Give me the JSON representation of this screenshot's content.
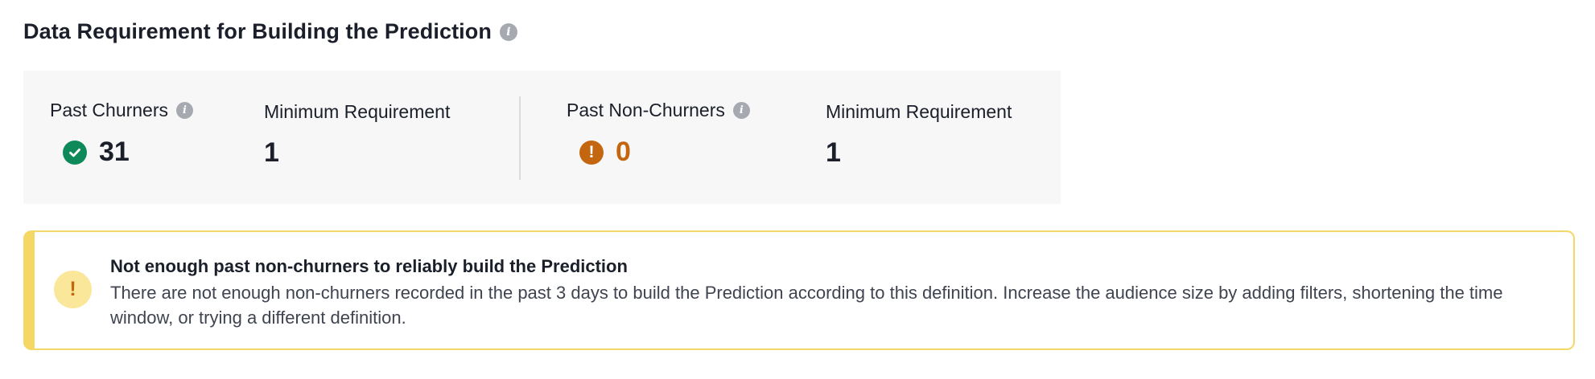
{
  "section": {
    "title": "Data Requirement for Building the Prediction",
    "info_icon": "info-icon"
  },
  "stats": {
    "past_churners": {
      "label": "Past Churners",
      "value": "31",
      "status": "ok",
      "status_icon": "check-circle-icon"
    },
    "churners_minimum": {
      "label": "Minimum Requirement",
      "value": "1"
    },
    "past_non_churners": {
      "label": "Past Non-Churners",
      "value": "0",
      "status": "warning",
      "status_icon": "exclamation-circle-icon"
    },
    "non_churners_minimum": {
      "label": "Minimum Requirement",
      "value": "1"
    }
  },
  "alert": {
    "icon": "exclamation-icon",
    "title": "Not enough past non-churners to reliably build the Prediction",
    "body": "There are not enough non-churners recorded in the past 3 days to build the Prediction according to this definition. Increase the audience size by adding filters, shortening the time window, or trying a different definition."
  },
  "colors": {
    "success": "#0e8a5a",
    "warning": "#c4660f",
    "alert_border": "#f5d766",
    "alert_icon_bg": "#fbe79a",
    "panel_bg": "#f7f7f7",
    "info_icon": "#a6a9b0"
  }
}
